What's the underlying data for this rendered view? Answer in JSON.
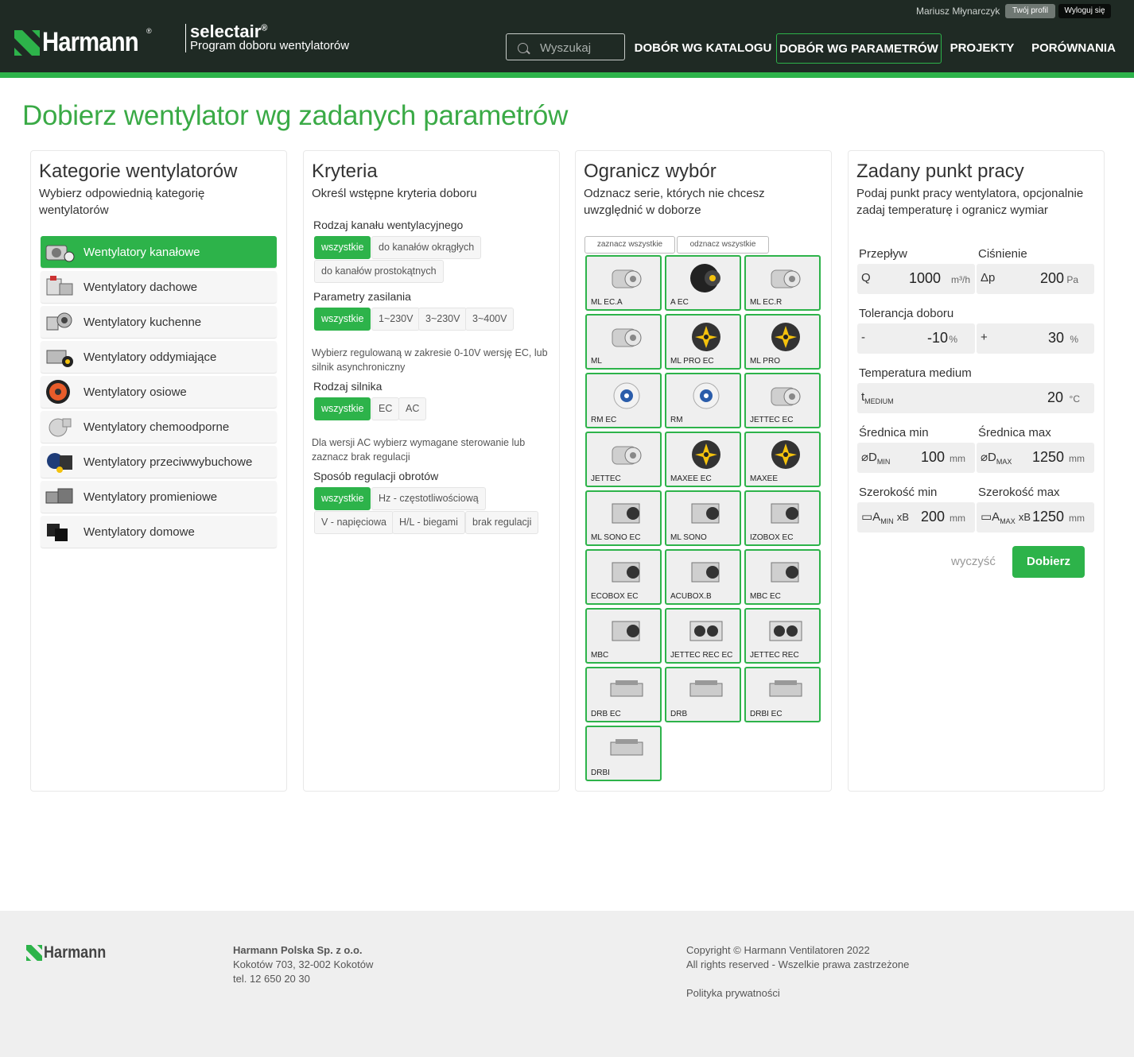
{
  "header": {
    "brand": "Harmann",
    "brand_reg": "®",
    "app_name": "selectair",
    "app_reg": "®",
    "app_subtitle": "Program doboru wentylatorów",
    "user_name": "Mariusz Młynarczyk",
    "profile_label": "Twój profil",
    "logout_label": "Wyloguj się",
    "search_placeholder": "Wyszukaj",
    "nav": [
      {
        "label": "DOBÓR WG KATALOGU",
        "active": false
      },
      {
        "label": "DOBÓR WG PARAMETRÓW",
        "active": true
      },
      {
        "label": "PROJEKTY",
        "active": false
      },
      {
        "label": "PORÓWNANIA",
        "active": false
      }
    ],
    "accent_color": "#2db34a",
    "dark_color": "#1f2a24"
  },
  "page_title": "Dobierz wentylator wg zadanych parametrów",
  "categories": {
    "title": "Kategorie wentylatorów",
    "description": "Wybierz odpowiednią kategorię wentylatorów",
    "items": [
      {
        "label": "Wentylatory kanałowe",
        "active": true
      },
      {
        "label": "Wentylatory dachowe",
        "active": false
      },
      {
        "label": "Wentylatory kuchenne",
        "active": false
      },
      {
        "label": "Wentylatory oddymiające",
        "active": false
      },
      {
        "label": "Wentylatory osiowe",
        "active": false
      },
      {
        "label": "Wentylatory chemoodporne",
        "active": false
      },
      {
        "label": "Wentylatory przeciwwybuchowe",
        "active": false
      },
      {
        "label": "Wentylatory promieniowe",
        "active": false
      },
      {
        "label": "Wentylatory domowe",
        "active": false
      }
    ]
  },
  "criteria": {
    "title": "Kryteria",
    "description": "Określ wstępne kryteria doboru",
    "duct_label": "Rodzaj kanału wentylacyjnego",
    "duct_options": [
      "wszystkie",
      "do kanałów okrągłych",
      "do kanałów prostokątnych"
    ],
    "power_label": "Parametry zasilania",
    "power_options": [
      "wszystkie",
      "1~230V",
      "3~230V",
      "3~400V"
    ],
    "motor_note": "Wybierz regulowaną w zakresie 0-10V wersję EC, lub silnik  asynchroniczny",
    "motor_label": "Rodzaj silnika",
    "motor_options": [
      "wszystkie",
      "EC",
      "AC"
    ],
    "control_note": "Dla wersji  AC  wybierz wymagane sterowanie lub zaznacz brak regulacji",
    "control_label": "Sposób regulacji obrotów",
    "control_options": [
      "wszystkie",
      "Hz - częstotliwościową",
      "V - napięciowa",
      "H/L - biegami",
      "brak regulacji"
    ]
  },
  "limit": {
    "title": "Ogranicz wybór",
    "description": "Odznacz serie, których nie chcesz uwzględnić w doborze",
    "select_all": "zaznacz wszystkie",
    "deselect_all": "odznacz wszystkie",
    "series": [
      "ML EC.A",
      "A EC",
      "ML EC.R",
      "ML",
      "ML PRO EC",
      "ML PRO",
      "RM EC",
      "RM",
      "JETTEC EC",
      "JETTEC",
      "MAXEE EC",
      "MAXEE",
      "ML SONO EC",
      "ML SONO",
      "IZOBOX EC",
      "ECOBOX EC",
      "ACUBOX.B",
      "MBC EC",
      "MBC",
      "JETTEC REC EC",
      "JETTEC REC",
      "DRB EC",
      "DRB",
      "DRBI EC",
      "DRBI"
    ]
  },
  "workpoint": {
    "title": "Zadany punkt pracy",
    "description": "Podaj punkt pracy wentylatora,  opcjonalnie zadaj temperaturę i ogranicz wymiar",
    "flow_label": "Przepływ",
    "flow_symbol": "Q",
    "flow_value": "1000",
    "flow_unit": "m³/h",
    "pressure_label": "Ciśnienie",
    "pressure_symbol": "Δp",
    "pressure_value": "200",
    "pressure_unit": "Pa",
    "tolerance_label": "Tolerancja doboru",
    "tol_minus_symbol": "-",
    "tol_minus_value": "-10",
    "tol_plus_symbol": "+",
    "tol_plus_value": "30",
    "tol_unit": "%",
    "temp_label": "Temperatura medium",
    "temp_symbol": "t",
    "temp_sub": "MEDIUM",
    "temp_value": "20",
    "temp_unit": "°C",
    "dmin_label": "Średnica min",
    "dmin_symbol": "⌀D",
    "dmin_sub": "MIN",
    "dmin_value": "100",
    "dmax_label": "Średnica  max",
    "dmax_symbol": "⌀D",
    "dmax_sub": "MAX",
    "dmax_value": "1250",
    "d_unit": "mm",
    "wmin_label": "Szerokość min",
    "wmin_symbol": "▭A",
    "wmin_sub": "MIN",
    "wmin_value": "200",
    "wmax_label": "Szerokość max",
    "wmax_symbol": "▭A",
    "wmax_sub": "MAX",
    "wmax_value": "1250",
    "w_suffix": "xB",
    "w_unit": "mm",
    "clear_label": "wyczyść",
    "submit_label": "Dobierz"
  },
  "footer": {
    "brand": "Harmann",
    "company": "Harmann Polska Sp. z o.o.",
    "address": "Kokotów 703, 32-002 Kokotów",
    "phone": "tel. 12 650 20 30",
    "copyright": "Copyright © Harmann Ventilatoren 2022",
    "rights": "All rights reserved - Wszelkie prawa zastrzeżone",
    "privacy": "Polityka prywatności"
  }
}
